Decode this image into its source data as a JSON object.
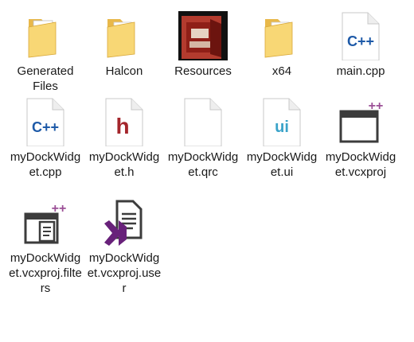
{
  "files": [
    {
      "label": "Generated\nFiles",
      "type": "folder",
      "icon": "folder-with-document-icon"
    },
    {
      "label": "Halcon",
      "type": "folder",
      "icon": "folder-icon"
    },
    {
      "label": "Resources",
      "type": "folder",
      "icon": "image-folder-icon"
    },
    {
      "label": "x64",
      "type": "folder",
      "icon": "folder-icon"
    },
    {
      "label": "main.cpp",
      "type": "cpp",
      "icon": "cpp-file-icon"
    },
    {
      "label": "myDockWidget.cpp",
      "type": "cpp",
      "icon": "cpp-file-icon"
    },
    {
      "label": "myDockWidget.h",
      "type": "header",
      "icon": "header-file-icon"
    },
    {
      "label": "myDockWidget.qrc",
      "type": "qrc",
      "icon": "blank-file-icon"
    },
    {
      "label": "myDockWidget.ui",
      "type": "ui",
      "icon": "ui-file-icon"
    },
    {
      "label": "myDockWidget.vcxproj",
      "type": "vcxproj",
      "icon": "vcxproj-file-icon"
    },
    {
      "label": "myDockWidget.vcxproj.filters",
      "type": "filters",
      "icon": "vcxproj-filters-file-icon"
    },
    {
      "label": "myDockWidget.vcxproj.user",
      "type": "user",
      "icon": "vcxproj-user-file-icon"
    }
  ],
  "colors": {
    "folder_front": "#f8d775",
    "folder_back": "#e8b84a",
    "cpp_blue": "#1e5aa8",
    "header_red": "#a4262c",
    "ui_teal": "#3aa3c9",
    "vs_purple": "#68217a",
    "plus_purple": "#9b4f96",
    "icon_dark": "#3c3c3c"
  }
}
